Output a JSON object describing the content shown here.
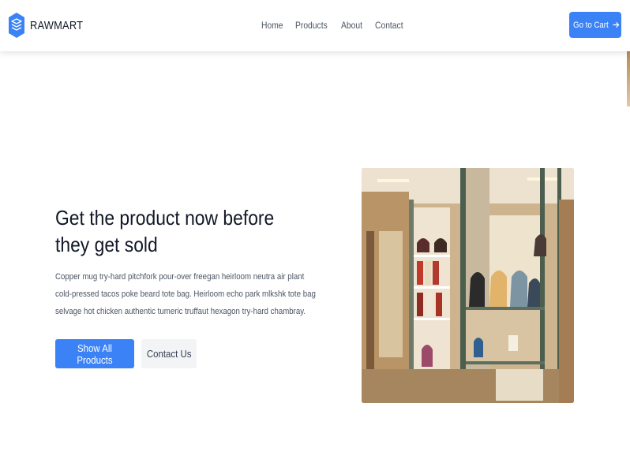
{
  "brand": {
    "name": "RAWMART",
    "icon": "stack-layers-icon",
    "accent": "#3b82f6"
  },
  "nav": {
    "items": [
      {
        "label": "Home"
      },
      {
        "label": "Products"
      },
      {
        "label": "About"
      },
      {
        "label": "Contact"
      }
    ]
  },
  "header": {
    "cart_label": "Go to Cart",
    "cart_icon": "arrow-right-icon"
  },
  "hero": {
    "title_line1": "Get the product now before",
    "title_line2": "they get sold",
    "description": "Copper mug try-hard pitchfork pour-over freegan heirloom neutra air plant cold-pressed tacos poke beard tote bag. Heirloom echo park mlkshk tote bag selvage hot chicken authentic tumeric truffaut hexagon try-hard chambray.",
    "primary_button": "Show All Products",
    "secondary_button": "Contact Us",
    "image": "store-interior-handbags-photo"
  }
}
